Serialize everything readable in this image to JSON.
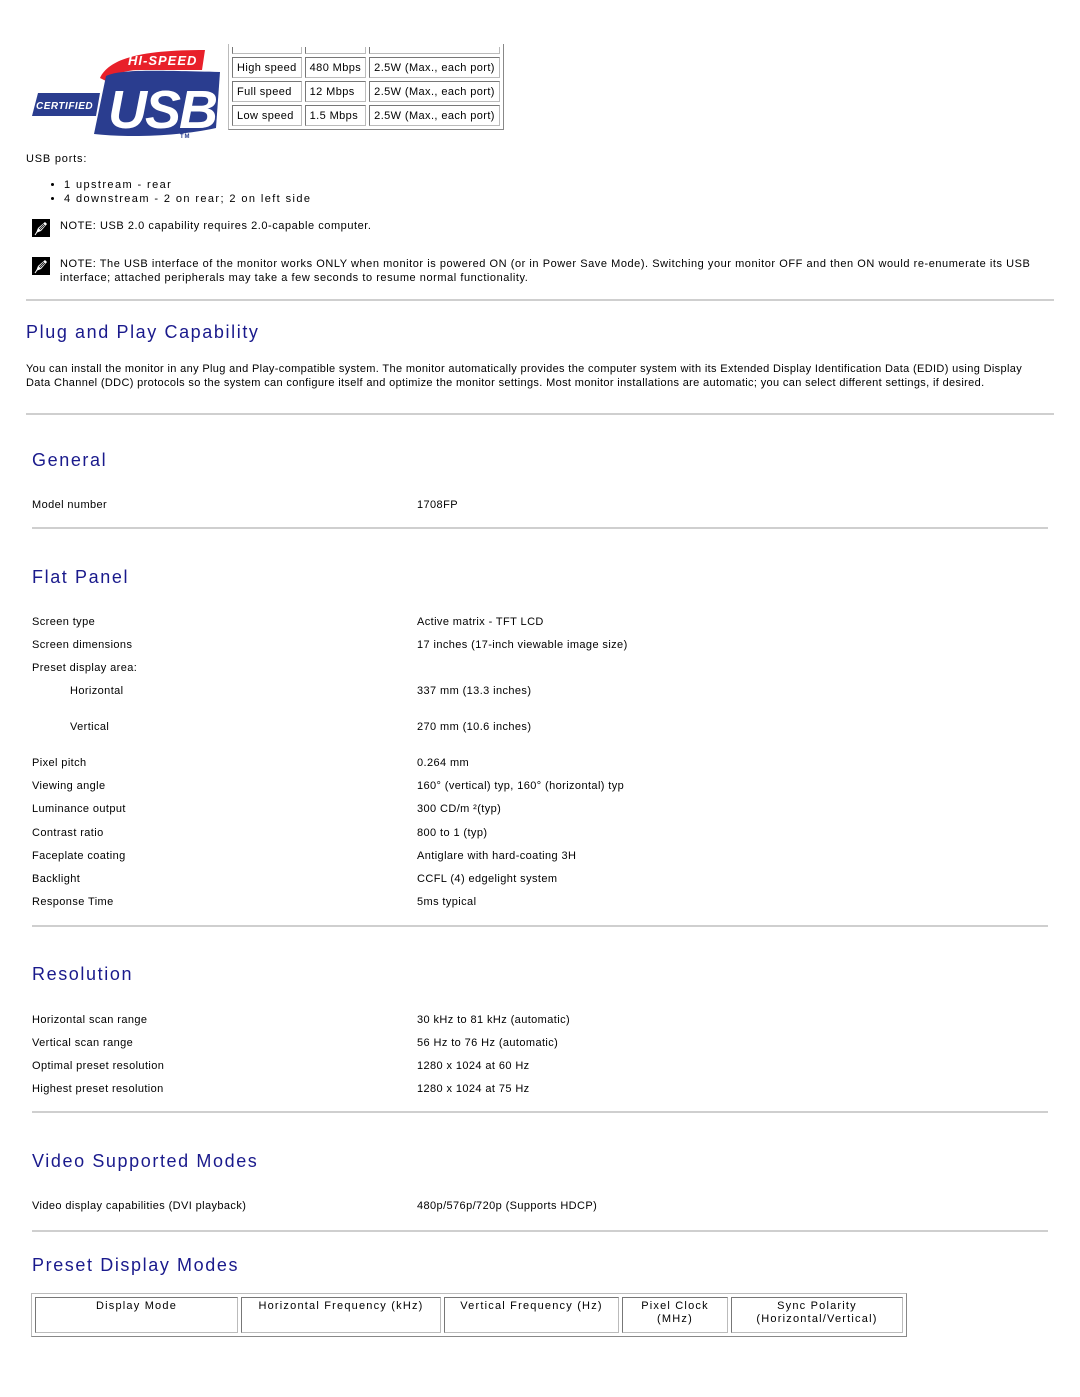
{
  "usb_logo": {
    "top_text": "HI-SPEED",
    "left_text": "CERTIFIED",
    "main_text": "USB",
    "tm": "TM",
    "colors": {
      "red": "#e8202a",
      "blue": "#2a3d8f",
      "white": "#ffffff"
    }
  },
  "usb_speed_table": {
    "rows": [
      [
        "High speed",
        "480 Mbps",
        "2.5W (Max., each port)"
      ],
      [
        "Full speed",
        "12 Mbps",
        "2.5W (Max., each port)"
      ],
      [
        "Low speed",
        "1.5 Mbps",
        "2.5W (Max., each port)"
      ]
    ]
  },
  "usb_ports": {
    "label": "USB ports:",
    "items": [
      "1 upstream - rear",
      "4 downstream - 2 on rear; 2 on left side"
    ]
  },
  "notes": [
    {
      "icon": "note-pencil-icon",
      "text": "NOTE: USB 2.0 capability requires 2.0-capable computer."
    },
    {
      "icon": "note-pencil-icon",
      "text": "NOTE: The USB interface of the monitor works ONLY when monitor is powered ON (or in Power Save Mode). Switching your monitor OFF and then ON would re-enumerate its USB interface; attached peripherals may take a few seconds to resume normal functionality."
    }
  ],
  "plug_and_play": {
    "title": "Plug and Play Capability",
    "body": "You can install the monitor in any Plug and Play-compatible system. The monitor automatically provides the computer system with its Extended Display Identification Data (EDID) using Display Data Channel (DDC) protocols so the system can configure itself and optimize the monitor settings. Most monitor installations are automatic; you can select different settings, if desired."
  },
  "general": {
    "title": "General",
    "rows": [
      {
        "key": "Model number",
        "value": "1708FP"
      }
    ]
  },
  "flat_panel": {
    "title": "Flat Panel",
    "rows": [
      {
        "key": "Screen type",
        "value": "Active matrix - TFT LCD"
      },
      {
        "key": "Screen dimensions",
        "value": "17 inches (17-inch viewable image size)"
      },
      {
        "key": "Preset display area:",
        "value": ""
      },
      {
        "key": "Horizontal",
        "value": "337 mm (13.3 inches)",
        "indent": true
      },
      {
        "key": "Vertical",
        "value": "270 mm (10.6 inches)",
        "indent": true
      },
      {
        "key": "Pixel pitch",
        "value": "0.264 mm"
      },
      {
        "key": "Viewing angle",
        "value": "160° (vertical) typ, 160° (horizontal) typ"
      },
      {
        "key": "Luminance output",
        "value": "300 CD/m ²(typ)"
      },
      {
        "key": "Contrast ratio",
        "value": "800 to 1 (typ)"
      },
      {
        "key": "Faceplate coating",
        "value": "Antiglare with hard-coating 3H"
      },
      {
        "key": "Backlight",
        "value": "CCFL (4) edgelight system"
      },
      {
        "key": "Response Time",
        "value": "5ms typical"
      }
    ]
  },
  "resolution": {
    "title": "Resolution",
    "rows": [
      {
        "key": "Horizontal scan range",
        "value": "30 kHz to 81 kHz (automatic)"
      },
      {
        "key": "Vertical scan range",
        "value": "56 Hz to 76 Hz (automatic)"
      },
      {
        "key": "Optimal preset resolution",
        "value": "1280 x 1024 at 60 Hz"
      },
      {
        "key": "Highest preset resolution",
        "value": "1280 x 1024 at 75 Hz"
      }
    ]
  },
  "video_modes": {
    "title": "Video Supported Modes",
    "rows": [
      {
        "key": "Video display capabilities (DVI playback)",
        "value": "480p/576p/720p (Supports HDCP)"
      }
    ]
  },
  "preset_modes": {
    "title": "Preset Display Modes",
    "headers": [
      [
        "Display Mode"
      ],
      [
        "Horizontal Frequency (kHz)"
      ],
      [
        "Vertical Frequency (Hz)"
      ],
      [
        "Pixel Clock",
        "(MHz)"
      ],
      [
        "Sync Polarity",
        "(Horizontal/Vertical)"
      ]
    ]
  },
  "colors": {
    "heading": "#1a1a8c",
    "rule": "#cfcfcf"
  }
}
